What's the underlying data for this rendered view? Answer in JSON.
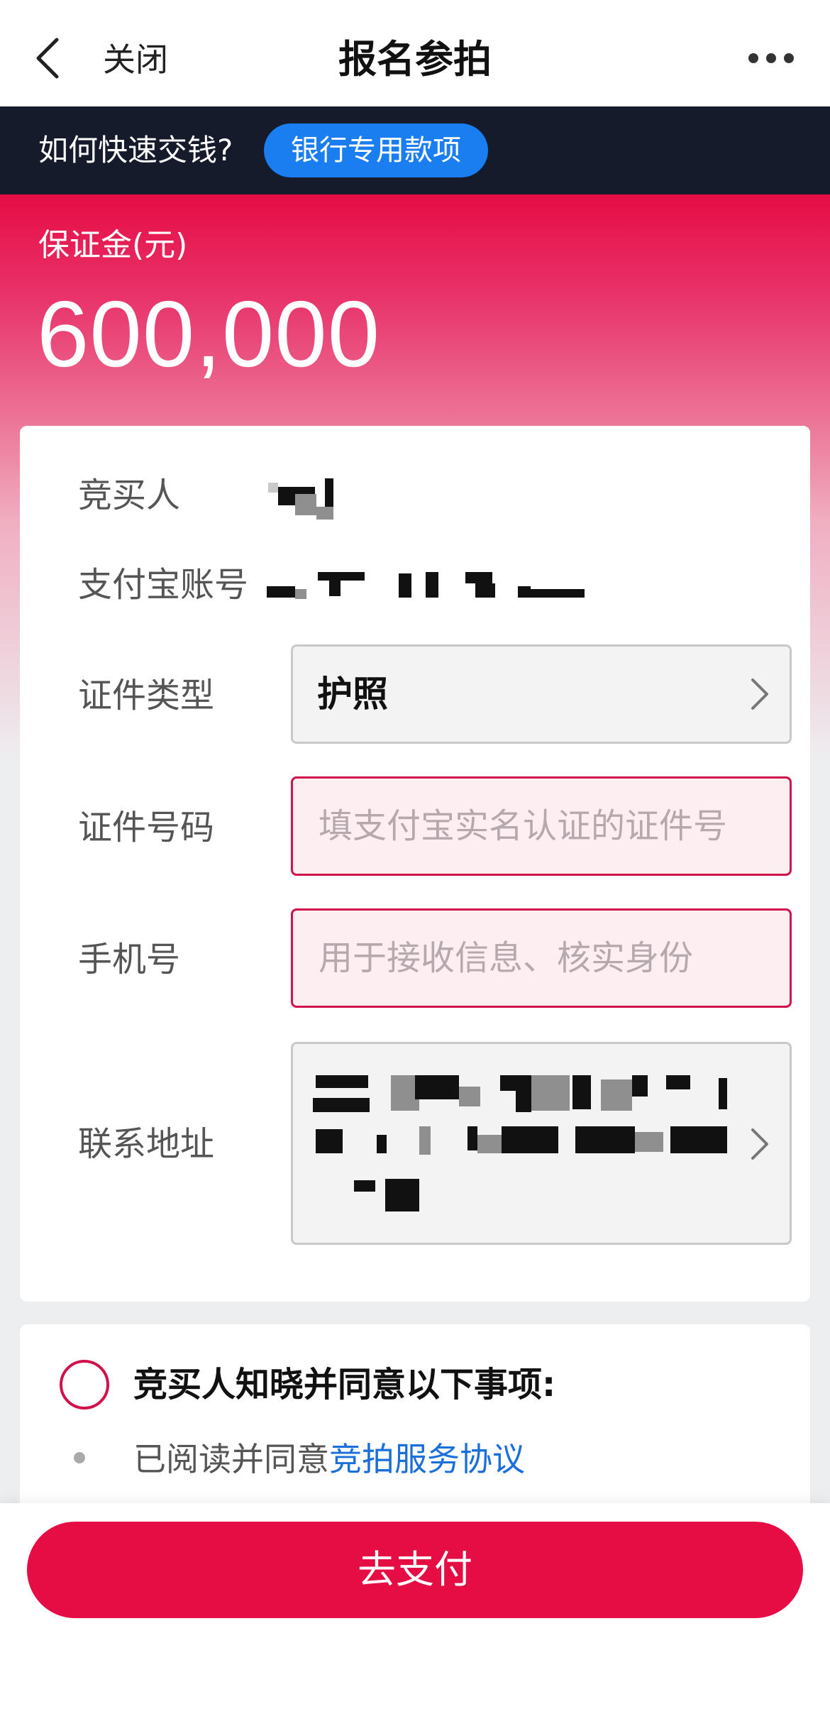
{
  "nav": {
    "back_icon": "chevron-left-icon",
    "close_label": "关闭",
    "title": "报名参拍",
    "more_icon": "more-horizontal-icon"
  },
  "banner": {
    "question": "如何快速交钱?",
    "button_label": "银行专用款项"
  },
  "deposit": {
    "label": "保证金(元)",
    "amount": "600,000"
  },
  "form": {
    "bidder_label": "竞买人",
    "alipay_label": "支付宝账号",
    "id_type_label": "证件类型",
    "id_type_value": "护照",
    "id_number_label": "证件号码",
    "id_number_placeholder": "填支付宝实名认证的证件号",
    "phone_label": "手机号",
    "phone_placeholder": "用于接收信息、核实身份",
    "address_label": "联系地址"
  },
  "agreement": {
    "title": "竞买人知晓并同意以下事项:",
    "item_prefix": "已阅读并同意",
    "item_link": "竞拍服务协议"
  },
  "footer": {
    "pay_label": "去支付"
  },
  "colors": {
    "brand_red": "#e60c44",
    "banner_bg": "#151b2a",
    "banner_button": "#1a7ef0",
    "link_blue": "#1a6fd8"
  }
}
